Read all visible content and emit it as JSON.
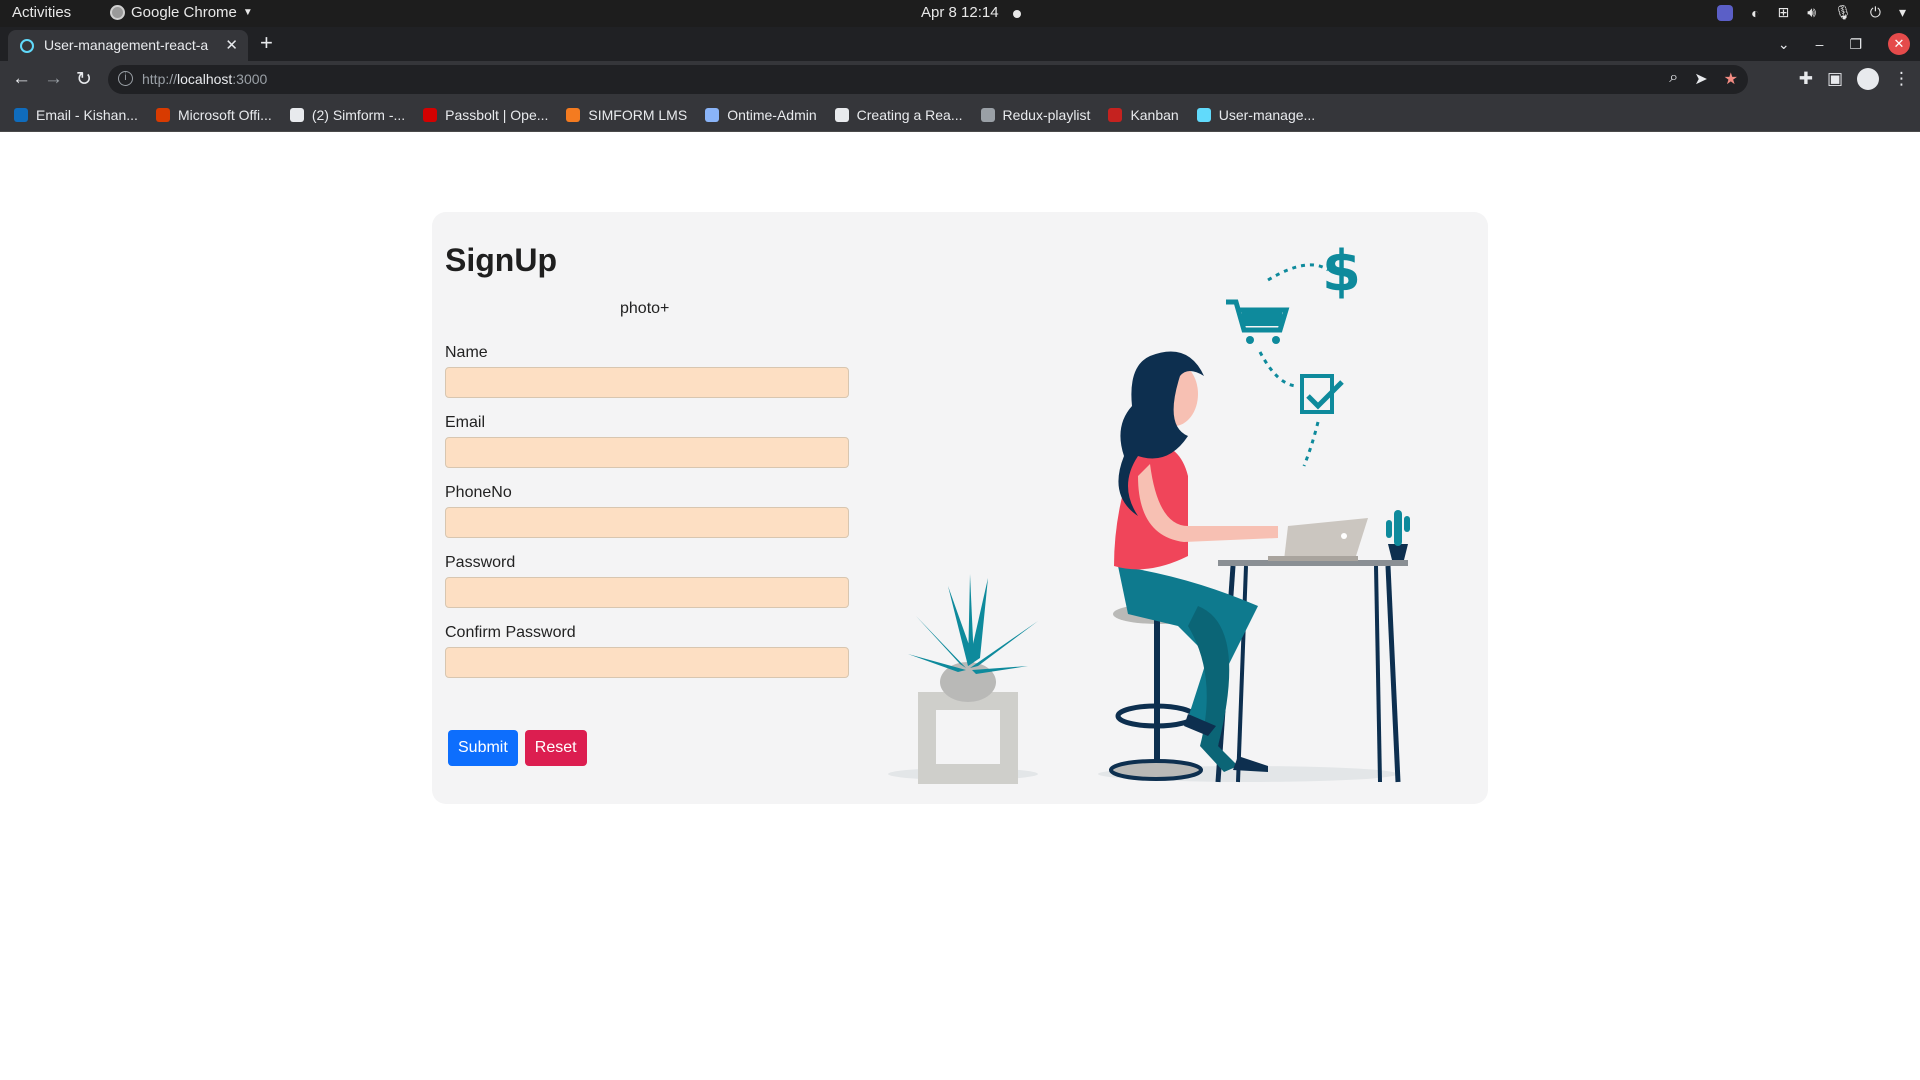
{
  "os_bar": {
    "activities": "Activities",
    "app_name": "Google Chrome",
    "clock": "Apr 8  12:14"
  },
  "browser": {
    "tab_title": "User-management-react-a",
    "url_scheme": "http://",
    "url_host": "localhost",
    "url_port": ":3000",
    "bookmarks": [
      {
        "label": "Email - Kishan...",
        "color": "#0f6cbd"
      },
      {
        "label": "Microsoft Offi...",
        "color": "#d83b01"
      },
      {
        "label": "(2) Simform -...",
        "color": "#e8eaed"
      },
      {
        "label": "Passbolt | Ope...",
        "color": "#d40101"
      },
      {
        "label": "SIMFORM LMS",
        "color": "#f47b20"
      },
      {
        "label": "Ontime-Admin",
        "color": "#8ab4f8"
      },
      {
        "label": "Creating a Rea...",
        "color": "#e8eaed"
      },
      {
        "label": "Redux-playlist",
        "color": "#9aa0a6"
      },
      {
        "label": "Kanban",
        "color": "#c5221f"
      },
      {
        "label": "User-manage...",
        "color": "#61dafb"
      }
    ]
  },
  "signup": {
    "title": "SignUp",
    "photo_label": "photo+",
    "fields": [
      {
        "label": "Name",
        "value": ""
      },
      {
        "label": "Email",
        "value": ""
      },
      {
        "label": "PhoneNo",
        "value": ""
      },
      {
        "label": "Password",
        "value": ""
      },
      {
        "label": "Confirm Password",
        "value": ""
      }
    ],
    "submit_label": "Submit",
    "reset_label": "Reset"
  },
  "colors": {
    "submit": "#0d6efd",
    "reset": "#dc1e50",
    "input_bg": "#fddfc3",
    "card_bg": "#f4f4f5",
    "accent_teal": "#0e8a9c"
  },
  "illustration": {
    "icon_name": "woman-working-on-laptop-illustration",
    "symbol": "$"
  }
}
